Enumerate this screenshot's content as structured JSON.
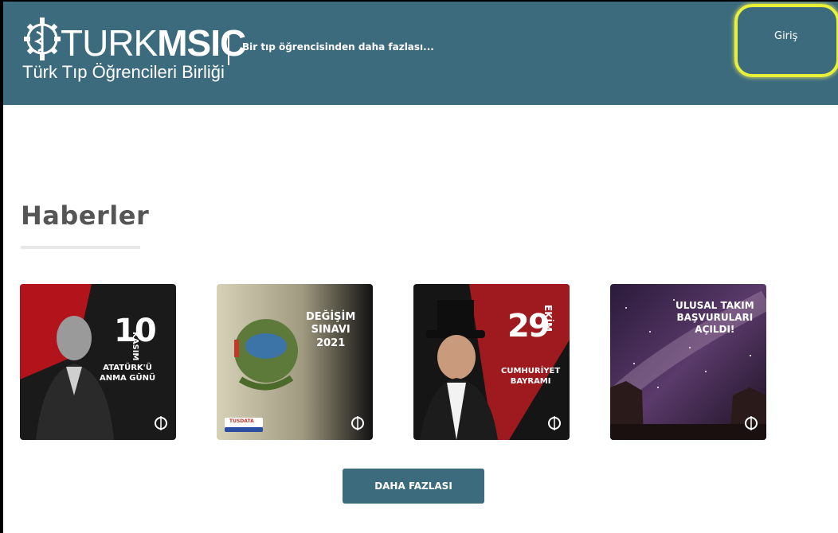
{
  "header": {
    "brand_light": "TURK",
    "brand_bold": "MSIC",
    "subtitle": "Türk Tıp Öğrencileri Birliği",
    "tagline": "Bir tıp öğrencisinden daha fazlası...",
    "login_label": "Giriş",
    "background_color": "#3d6b7e"
  },
  "main": {
    "section_title": "Haberler",
    "more_button_label": "DAHA FAZLASI",
    "news": [
      {
        "big": "10",
        "side": "KASIM",
        "caption": "ATATÜRK'Ü\nANMA GÜNÜ"
      },
      {
        "caption": "DEĞİŞİM\nSINAVI\n2021",
        "badge": "TUSDATA"
      },
      {
        "big": "29",
        "side": "EKİM",
        "caption": "CUMHURİYET\nBAYRAMI"
      },
      {
        "caption": "ULUSAL TAKIM\nBAŞVURULARI\nAÇILDI!"
      }
    ]
  },
  "colors": {
    "accent": "#3d6b7e",
    "highlight": "#e8f03a",
    "title": "#555555"
  }
}
